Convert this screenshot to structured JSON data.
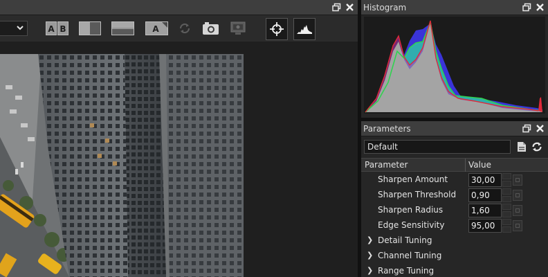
{
  "viewer": {
    "toolbar": {
      "compare_ab_label": "A B",
      "split_view_label": "split-vertical",
      "split_horizontal_label": "split-horizontal",
      "text_overlay_label": "A",
      "icons": [
        "chevron-down-icon",
        "ab-compare-icon",
        "split-vertical-icon",
        "split-horizontal-icon",
        "text-overlay-icon",
        "refresh-icon",
        "camera-icon",
        "monitor-icon",
        "crosshair-icon",
        "histogram-icon"
      ]
    }
  },
  "histogram": {
    "title": "Histogram",
    "channel_colors": {
      "red": "#e0293a",
      "green": "#2fd34f",
      "blue": "#3a34d8",
      "luma": "#9a9a9a",
      "magenta": "#c22fbf",
      "cyan": "#2fd3c0"
    }
  },
  "parameters": {
    "title": "Parameters",
    "preset": "Default",
    "columns": [
      "Parameter",
      "Value"
    ],
    "rows": [
      {
        "label": "Sharpen Amount",
        "value": "30,00"
      },
      {
        "label": "Sharpen Threshold",
        "value": "0,90"
      },
      {
        "label": "Sharpen Radius",
        "value": "1,60"
      },
      {
        "label": "Edge Sensitivity",
        "value": "95,00"
      }
    ],
    "groups": [
      {
        "chevron": "❯",
        "label": "Detail Tuning"
      },
      {
        "chevron": "❯",
        "label": "Channel Tuning"
      },
      {
        "chevron": "❯",
        "label": "Range Tuning"
      }
    ]
  },
  "colors": {
    "panel_bg": "#262626",
    "titlebar_bg": "#3e3e3e",
    "accent_active": "#ffffff"
  }
}
